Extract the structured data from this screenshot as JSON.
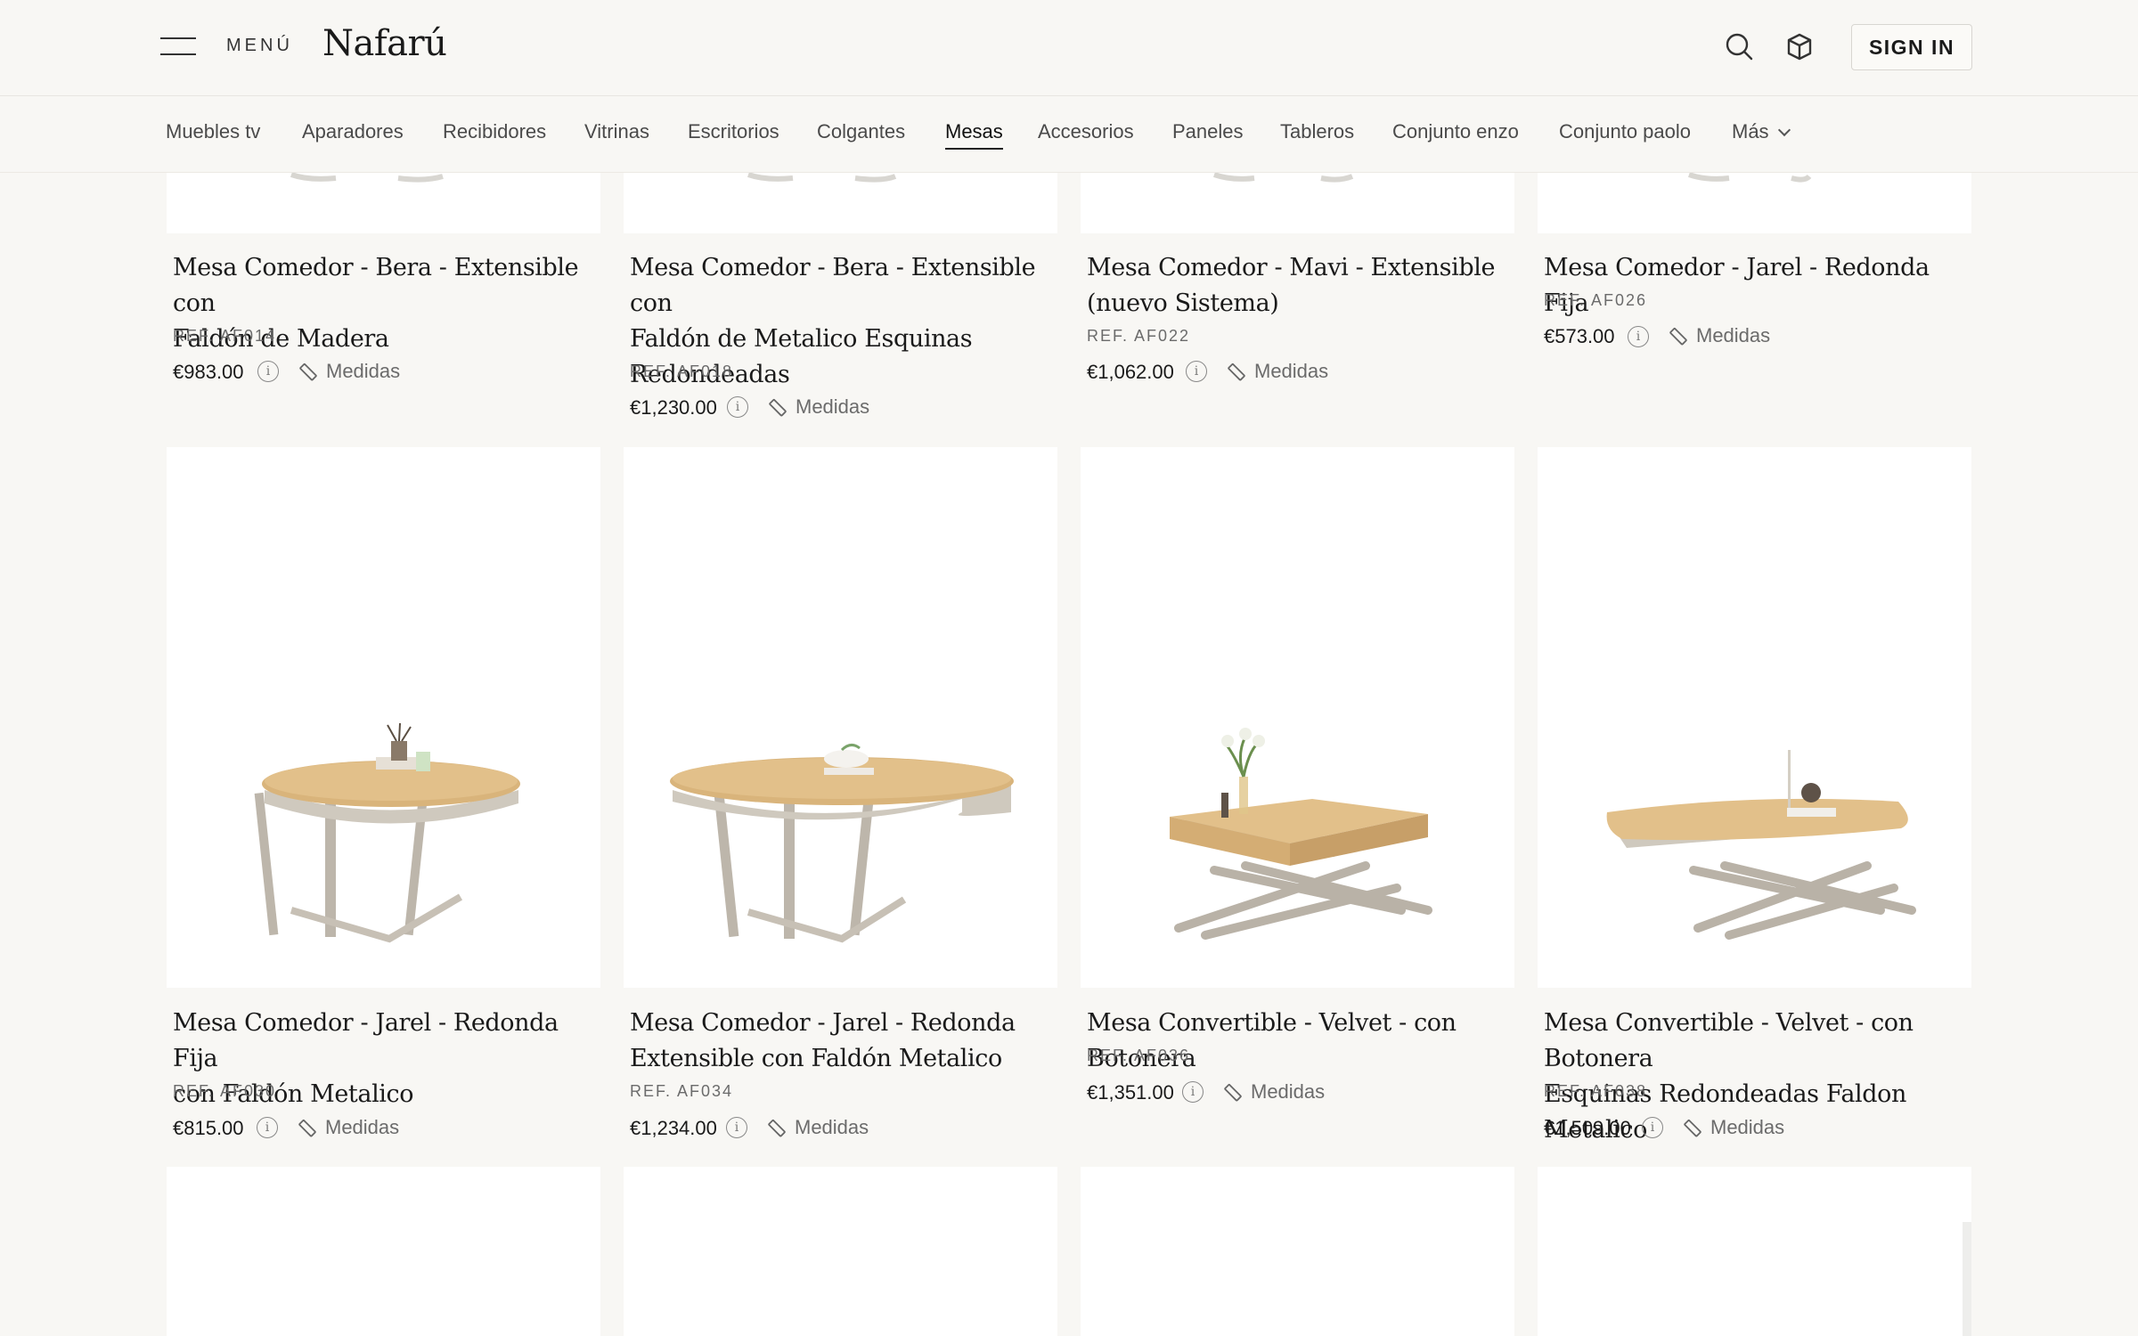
{
  "header": {
    "menu_label": "MENÚ",
    "logo": "Nafarú",
    "signin": "SIGN IN"
  },
  "nav": {
    "categories": [
      "Muebles tv",
      "Aparadores",
      "Recibidores",
      "Vitrinas",
      "Escritorios",
      "Colgantes",
      "Mesas",
      "Accesorios",
      "Paneles",
      "Tableros",
      "Conjunto enzo",
      "Conjunto paolo"
    ],
    "more": "Más",
    "active": "Mesas"
  },
  "products": [
    {
      "title_l1": "Mesa Comedor - Bera - Extensible con",
      "title_l2": "Faldón de Madera",
      "title_l3": "",
      "ref": "REF. AF014",
      "price": "€983.00",
      "medidas": "Medidas"
    },
    {
      "title_l1": "Mesa Comedor - Bera - Extensible con",
      "title_l2": "Faldón de Metalico Esquinas",
      "title_l3": "Redondeadas",
      "ref": "REF. AF018",
      "price": "€1,230.00",
      "medidas": "Medidas"
    },
    {
      "title_l1": "Mesa Comedor - Mavi - Extensible",
      "title_l2": "(nuevo Sistema)",
      "title_l3": "",
      "ref": "REF. AF022",
      "price": "€1,062.00",
      "medidas": "Medidas"
    },
    {
      "title_l1": "Mesa Comedor - Jarel - Redonda Fija",
      "title_l2": "",
      "title_l3": "",
      "ref": "REF. AF026",
      "price": "€573.00",
      "medidas": "Medidas"
    },
    {
      "title_l1": "Mesa Comedor - Jarel - Redonda Fija",
      "title_l2": "con Faldón Metalico",
      "title_l3": "",
      "ref": "REF. AF030",
      "price": "€815.00",
      "medidas": "Medidas"
    },
    {
      "title_l1": "Mesa Comedor - Jarel - Redonda",
      "title_l2": "Extensible con Faldón Metalico",
      "title_l3": "",
      "ref": "REF. AF034",
      "price": "€1,234.00",
      "medidas": "Medidas"
    },
    {
      "title_l1": "Mesa Convertible - Velvet - con Botonera",
      "title_l2": "",
      "title_l3": "",
      "ref": "REF. AF036",
      "price": "€1,351.00",
      "medidas": "Medidas"
    },
    {
      "title_l1": "Mesa Convertible - Velvet - con Botonera",
      "title_l2": "Esquinas Redondeadas Faldon Metalico",
      "title_l3": "",
      "ref": "REF. AF038",
      "price": "€1,509.00",
      "medidas": "Medidas"
    }
  ]
}
